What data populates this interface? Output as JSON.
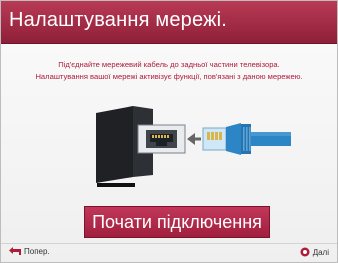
{
  "header": {
    "title": "Налаштування мережі."
  },
  "description": {
    "line1": "Під'єднайте мережевий кабель до задньої частини телевізора.",
    "line2": "Налаштування вашої мережі активізує функції, пов'язані з даною мережею."
  },
  "actions": {
    "connect_label": "Почати підключення"
  },
  "footer": {
    "back_label": "Попер.",
    "next_label": "Далі"
  },
  "colors": {
    "accent": "#a3203f",
    "text_accent": "#b01b37",
    "cable": "#2c86c5"
  }
}
